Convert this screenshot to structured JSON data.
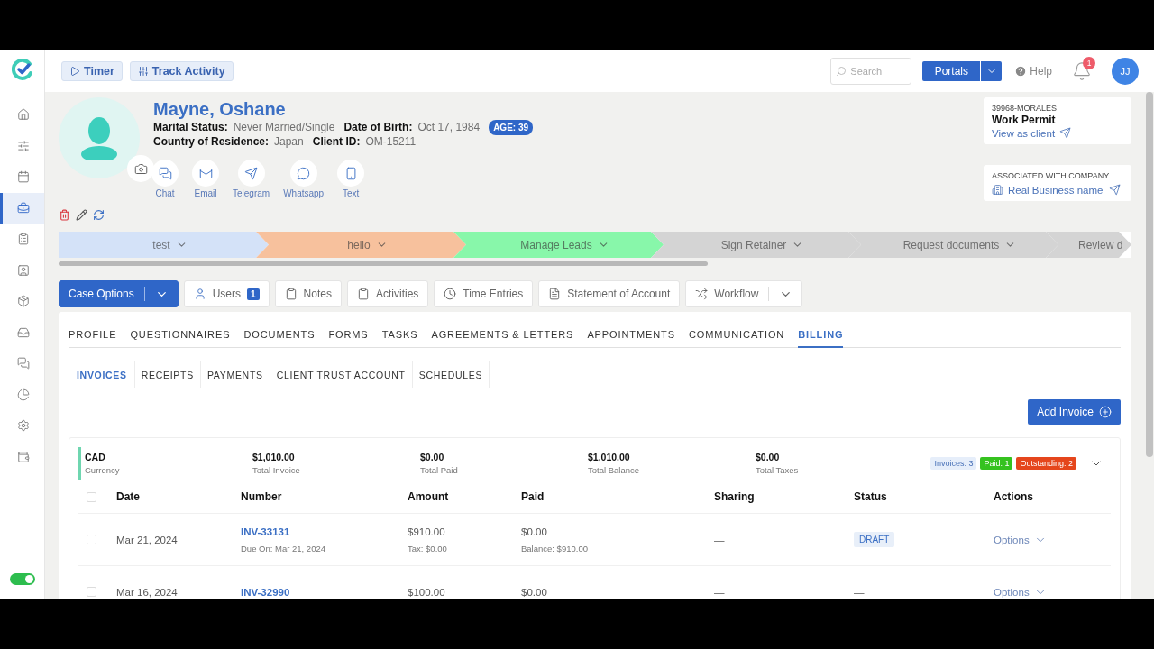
{
  "sidebar": {
    "items": [
      {
        "kind": "home",
        "selected": false
      },
      {
        "kind": "sliders",
        "selected": false
      },
      {
        "kind": "calendar",
        "selected": false
      },
      {
        "kind": "briefcase",
        "selected": true
      },
      {
        "kind": "clipboard",
        "selected": false
      },
      {
        "kind": "contact",
        "selected": false
      },
      {
        "kind": "package",
        "selected": false
      },
      {
        "kind": "inbox",
        "selected": false
      },
      {
        "kind": "messages",
        "selected": false
      },
      {
        "kind": "chart",
        "selected": false
      },
      {
        "kind": "settings",
        "selected": false
      },
      {
        "kind": "wallet",
        "selected": false
      }
    ],
    "toggle": {
      "on": true
    }
  },
  "header": {
    "buttons": [
      {
        "label": "Timer",
        "kind": "timer"
      },
      {
        "label": "Track Activity",
        "kind": "activity"
      }
    ],
    "search": {
      "placeholder": "Search"
    },
    "portals": "Portals",
    "help": "Help",
    "notifications": "1",
    "avatar": "JJ"
  },
  "client": {
    "name": "Mayne, Oshane",
    "lines": [
      [
        {
          "label": "Marital Status:",
          "value": "Never Married/Single"
        },
        {
          "label": "Date of Birth:",
          "value": "Oct 17, 1984"
        }
      ],
      [
        {
          "label": "Country of Residence:",
          "value": "Japan"
        },
        {
          "label": "Client ID:",
          "value": "OM-15211"
        }
      ]
    ],
    "age": "AGE: 39"
  },
  "contacts": [
    {
      "label": "Chat",
      "kind": "chat"
    },
    {
      "label": "Email",
      "kind": "email"
    },
    {
      "label": "Telegram",
      "kind": "telegram"
    },
    {
      "label": "Whatsapp",
      "kind": "whatsapp"
    },
    {
      "label": "Text",
      "kind": "text"
    }
  ],
  "case_card": {
    "code": "39968-MORALES",
    "title": "Work Permit",
    "link": "View as client"
  },
  "company_card": {
    "heading": "ASSOCIATED WITH COMPANY",
    "link": "Real Business name"
  },
  "stages": [
    {
      "label": "test",
      "color": "#d4e2f8"
    },
    {
      "label": "hello",
      "color": "#f7c19d"
    },
    {
      "label": "Manage Leads",
      "color": "#88f7aa"
    },
    {
      "label": "Sign Retainer",
      "color": "#d4d4d4"
    },
    {
      "label": "Request documents",
      "color": "#d4d4d4"
    },
    {
      "label": "Review d",
      "color": "#d4d4d4"
    }
  ],
  "toolbar": [
    {
      "label": "Case Options",
      "kind": "primary"
    },
    {
      "label": "Users",
      "kind": "users",
      "count": "1"
    },
    {
      "label": "Notes",
      "kind": "notes"
    },
    {
      "label": "Activities",
      "kind": "activities"
    },
    {
      "label": "Time Entries",
      "kind": "time"
    },
    {
      "label": "Statement of Account",
      "kind": "statement"
    },
    {
      "label": "Workflow",
      "kind": "workflow"
    }
  ],
  "tabs": [
    {
      "label": "PROFILE",
      "selected": false
    },
    {
      "label": "QUESTIONNAIRES",
      "selected": false
    },
    {
      "label": "DOCUMENTS",
      "selected": false
    },
    {
      "label": "FORMS",
      "selected": false
    },
    {
      "label": "TASKS",
      "selected": false
    },
    {
      "label": "AGREEMENTS & LETTERS",
      "selected": false
    },
    {
      "label": "APPOINTMENTS",
      "selected": false
    },
    {
      "label": "COMMUNICATION",
      "selected": false
    },
    {
      "label": "BILLING",
      "selected": true
    }
  ],
  "subtabs": [
    {
      "label": "INVOICES",
      "selected": true
    },
    {
      "label": "RECEIPTS",
      "selected": false
    },
    {
      "label": "PAYMENTS",
      "selected": false
    },
    {
      "label": "CLIENT TRUST ACCOUNT",
      "selected": false
    },
    {
      "label": "SCHEDULES",
      "selected": false
    }
  ],
  "add_invoice": "Add Invoice",
  "summary": [
    {
      "value": "CAD",
      "label": "Currency"
    },
    {
      "value": "$1,010.00",
      "label": "Total Invoice"
    },
    {
      "value": "$0.00",
      "label": "Total Paid"
    },
    {
      "value": "$1,010.00",
      "label": "Total Balance"
    },
    {
      "value": "$0.00",
      "label": "Total Taxes"
    }
  ],
  "badges": [
    {
      "label": "Invoices: 3",
      "color": "#e6eefa"
    },
    {
      "label": "Paid: 1",
      "color": "#35c21f"
    },
    {
      "label": "Outstanding: 2",
      "color": "#e5461c"
    }
  ],
  "table": {
    "columns": [
      "Date",
      "Number",
      "Amount",
      "Paid",
      "Sharing",
      "Status",
      "Actions"
    ],
    "header_checked": false,
    "rows": [
      {
        "checked": false,
        "date": "Mar 21, 2024",
        "number": "INV-33131",
        "due": "Due On: Mar 21, 2024",
        "amount": "$910.00",
        "tax": "Tax: $0.00",
        "paid": "$0.00",
        "balance": "Balance: $910.00",
        "sharing": "—",
        "status": "DRAFT",
        "status_badge": true,
        "action": "Options"
      },
      {
        "checked": false,
        "date": "Mar 16, 2024",
        "number": "INV-32990",
        "amount": "$100.00",
        "paid": "$0.00",
        "sharing": "—",
        "status": "—",
        "status_badge": false,
        "action": "Options"
      }
    ]
  }
}
